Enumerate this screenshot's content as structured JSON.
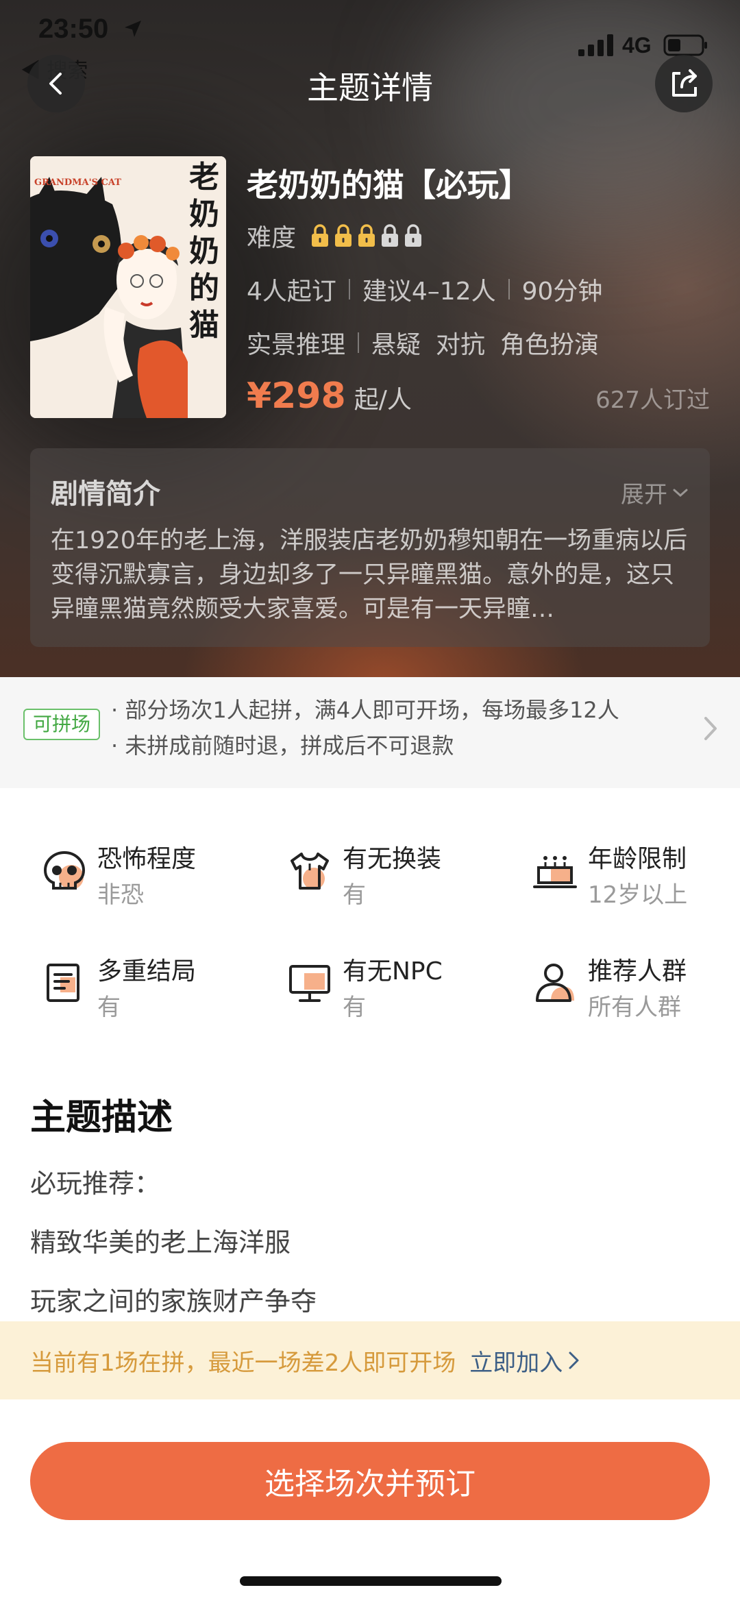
{
  "status_bar": {
    "time": "23:50",
    "back_app": "◀ 搜索",
    "network": "4G"
  },
  "nav": {
    "title": "主题详情"
  },
  "poster": {
    "text_en": "GRANDMA'S CAT",
    "text_cn": [
      "老",
      "奶",
      "奶",
      "的",
      "猫"
    ]
  },
  "theme": {
    "title": "老奶奶的猫【必玩】",
    "difficulty_label": "难度",
    "difficulty": {
      "level": 3,
      "max": 5
    },
    "meta": [
      "4人起订",
      "建议4–12人",
      "90分钟"
    ],
    "tags": {
      "primary": "实景推理",
      "others": [
        "悬疑",
        "对抗",
        "角色扮演"
      ]
    },
    "price": "¥298",
    "price_unit": "起/人",
    "booked": "627人订过"
  },
  "synopsis": {
    "title": "剧情简介",
    "expand": "展开",
    "body": "在1920年的老上海，洋服装店老奶奶穆知朝在一场重病以后变得沉默寡言，身边却多了一只异瞳黑猫。意外的是，这只异瞳黑猫竟然颇受大家喜爱。可是有一天异瞳…"
  },
  "group": {
    "badge": "可拼场",
    "lines": [
      "· 部分场次1人起拼，满4人即可开场，每场最多12人",
      "· 未拼成前随时退，拼成后不可退款"
    ]
  },
  "features": [
    {
      "icon": "skull-icon",
      "label": "恐怖程度",
      "value": "非恐"
    },
    {
      "icon": "shirt-icon",
      "label": "有无换装",
      "value": "有"
    },
    {
      "icon": "cake-icon",
      "label": "年龄限制",
      "value": "12岁以上"
    },
    {
      "icon": "document-icon",
      "label": "多重结局",
      "value": "有"
    },
    {
      "icon": "monitor-icon",
      "label": "有无NPC",
      "value": "有"
    },
    {
      "icon": "person-icon",
      "label": "推荐人群",
      "value": "所有人群"
    }
  ],
  "description": {
    "title": "主题描述",
    "lines": [
      "必玩推荐：",
      "精致华美的老上海洋服",
      "玩家之间的家族财产争夺"
    ]
  },
  "notice": {
    "text": "当前有1场在拼，最近一场差2人即可开场",
    "link": "立即加入"
  },
  "cta": {
    "label": "选择场次并预订"
  },
  "colors": {
    "accent": "#ee6c44",
    "price": "#f07c4e",
    "notice_bg": "#fcf1d7",
    "group_green": "#43a843"
  }
}
